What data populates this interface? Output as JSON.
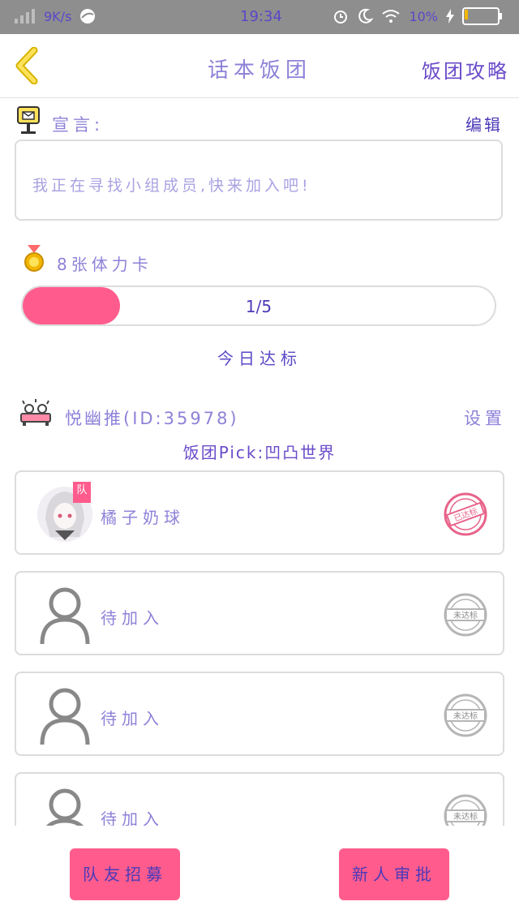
{
  "status_bar": {
    "speed": "9K/s",
    "time": "19:34",
    "battery_percent": "10%",
    "battery_level": 0.1
  },
  "nav": {
    "title": "话本饭团",
    "right_link": "饭团攻略"
  },
  "declaration": {
    "label": "宣言:",
    "edit": "编辑",
    "text": "我正在寻找小组成员,快来加入吧!"
  },
  "stamina": {
    "label": "8张体力卡",
    "progress_text": "1/5",
    "progress_value": 0.2,
    "goal": "今日达标"
  },
  "leader": {
    "name": "悦幽推(ID:35978)",
    "settings": "设置"
  },
  "pick": "饭团Pick:凹凸世界",
  "members": [
    {
      "name": "橘子奶球",
      "is_captain": true,
      "captain_badge": "队",
      "status": "已达标"
    },
    {
      "name": "待加入",
      "is_captain": false,
      "status": "未达标"
    },
    {
      "name": "待加入",
      "is_captain": false,
      "status": "未达标"
    },
    {
      "name": "待加入",
      "is_captain": false,
      "status": "未达标"
    }
  ],
  "buttons": {
    "recruit": "队友招募",
    "approve": "新人审批"
  },
  "colors": {
    "accent_pink": "#ff5c8d",
    "text_purple": "#8d82d8",
    "text_dark_purple": "#4b3ab8",
    "border_gray": "#dcdcdc"
  }
}
